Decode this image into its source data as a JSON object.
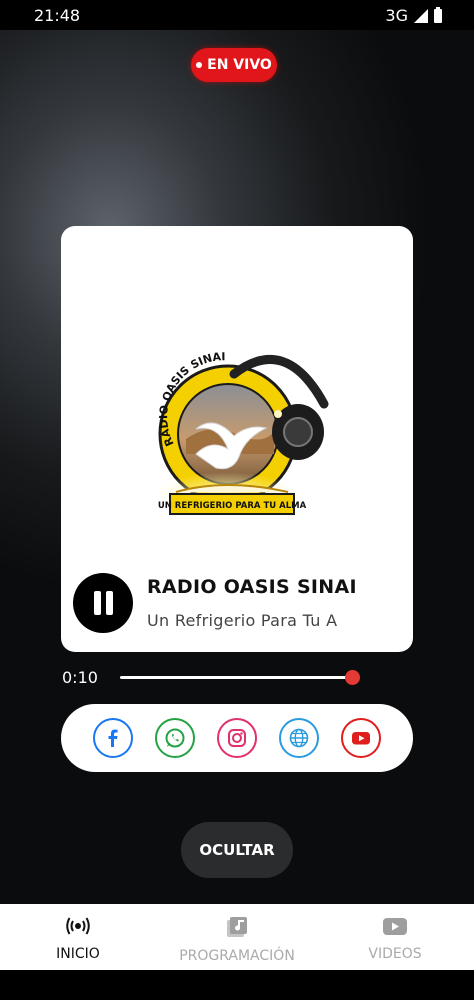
{
  "status_bar": {
    "time": "21:48",
    "network": "3G",
    "icons": [
      "signal-icon",
      "battery-icon"
    ]
  },
  "live_badge": {
    "label": "EN VIVO",
    "color": "#e0161b"
  },
  "player": {
    "logo_texts": {
      "ring": "RADIO OASIS SINAI",
      "banner": "UN REFRIGERIO PARA TU ALMA"
    },
    "station_name": "RADIO OASIS SINAI",
    "slogan": "Un Refrigerio Para Tu A",
    "state_icon": "pause-icon",
    "elapsed": "0:10"
  },
  "social_links": [
    {
      "icon": "facebook-icon",
      "color": "#1877f2"
    },
    {
      "icon": "whatsapp-icon",
      "color": "#25a244"
    },
    {
      "icon": "instagram-icon",
      "color": "#e1306c"
    },
    {
      "icon": "globe-icon",
      "color": "#2b9be0"
    },
    {
      "icon": "youtube-icon",
      "color": "#e01e1e"
    }
  ],
  "hide_button": {
    "label": "OCULTAR"
  },
  "bottom_nav": {
    "items": [
      {
        "label": "INICIO",
        "icon": "radio-broadcast-icon",
        "active": true
      },
      {
        "label": "PROGRAMACIÓN",
        "icon": "music-library-icon",
        "active": false
      },
      {
        "label": "VIDEOS",
        "icon": "video-play-icon",
        "active": false
      }
    ]
  },
  "accent_color": "#e53935"
}
